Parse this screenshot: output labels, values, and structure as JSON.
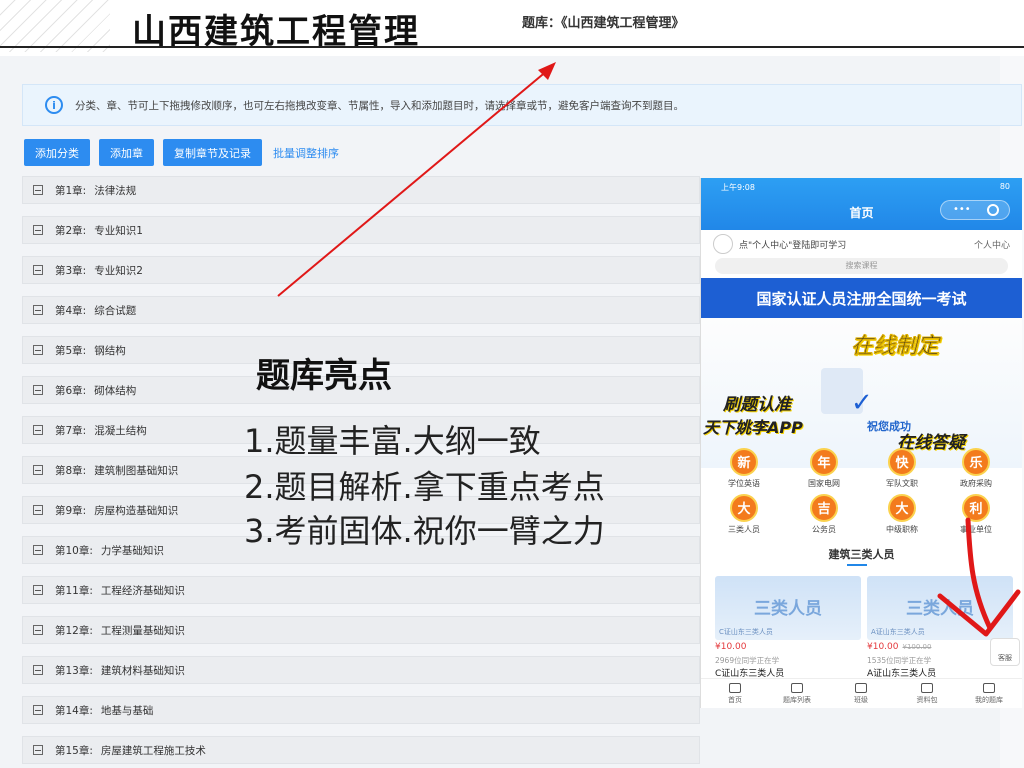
{
  "header": {
    "big_title": "山西建筑工程管理",
    "bank_label": "题库：《山西建筑工程管理》"
  },
  "notice": {
    "text": "分类、章、节可上下拖拽修改顺序，也可左右拖拽改变章、节属性，导入和添加题目时，请选择章或节，避免客户端查询不到题目。"
  },
  "toolbar": {
    "add_category": "添加分类",
    "add_chapter": "添加章",
    "copy_chapter": "复制章节及记录",
    "batch_sort": "批量调整排序"
  },
  "chapters": [
    {
      "num": "第1章:",
      "title": "法律法规"
    },
    {
      "num": "第2章:",
      "title": "专业知识1"
    },
    {
      "num": "第3章:",
      "title": "专业知识2"
    },
    {
      "num": "第4章:",
      "title": "综合试题"
    },
    {
      "num": "第5章:",
      "title": "钢结构"
    },
    {
      "num": "第6章:",
      "title": "砌体结构"
    },
    {
      "num": "第7章:",
      "title": "混凝土结构"
    },
    {
      "num": "第8章:",
      "title": "建筑制图基础知识"
    },
    {
      "num": "第9章:",
      "title": "房屋构造基础知识"
    },
    {
      "num": "第10章:",
      "title": "力学基础知识"
    },
    {
      "num": "第11章:",
      "title": "工程经济基础知识"
    },
    {
      "num": "第12章:",
      "title": "工程测量基础知识"
    },
    {
      "num": "第13章:",
      "title": "建筑材料基础知识"
    },
    {
      "num": "第14章:",
      "title": "地基与基础"
    },
    {
      "num": "第15章:",
      "title": "房屋建筑工程施工技术"
    }
  ],
  "highlights": {
    "title": "题库亮点",
    "lines": [
      "1.题量丰富.大纲一致",
      "2.题目解析.拿下重点考点",
      "3.考前固体.祝你一臂之力"
    ]
  },
  "phone": {
    "status_left": "上午9:08",
    "status_right": "80",
    "title": "首页",
    "user_prompt": "点\"个人中心\"登陆即可学习",
    "user_link": "个人中心",
    "search_placeholder": "搜索课程",
    "banner": "国家认证人员注册全国统一考试",
    "promo_a": "在线制定",
    "promo_b": "刷题认准",
    "promo_c": "天下姚李APP",
    "promo_d": "祝您成功",
    "promo_e": "在线答疑",
    "grid": [
      {
        "badge": "新",
        "label": "学位英语"
      },
      {
        "badge": "年",
        "label": "国家电网"
      },
      {
        "badge": "快",
        "label": "军队文职"
      },
      {
        "badge": "乐",
        "label": "政府采购"
      },
      {
        "badge": "大",
        "label": "三类人员"
      },
      {
        "badge": "吉",
        "label": "公务员"
      },
      {
        "badge": "大",
        "label": "中级职称"
      },
      {
        "badge": "利",
        "label": "事业单位"
      }
    ],
    "section_title": "建筑三类人员",
    "cards": [
      {
        "title": "三类人员",
        "sub": "C证山东三类人员",
        "price": "¥10.00",
        "old": "",
        "study": "2969位同学正在学",
        "name": "C证山东三类人员"
      },
      {
        "title": "三类人员",
        "sub": "A证山东三类人员",
        "price": "¥10.00",
        "old": "¥100.00",
        "study": "1535位同学正在学",
        "name": "A证山东三类人员"
      }
    ],
    "service": "客服",
    "tabs": [
      "首页",
      "题库列表",
      "班级",
      "资料包",
      "我的题库"
    ]
  },
  "colors": {
    "accent": "#2d8cf0",
    "arrow": "#e01818",
    "banner": "#1d5fd3"
  }
}
